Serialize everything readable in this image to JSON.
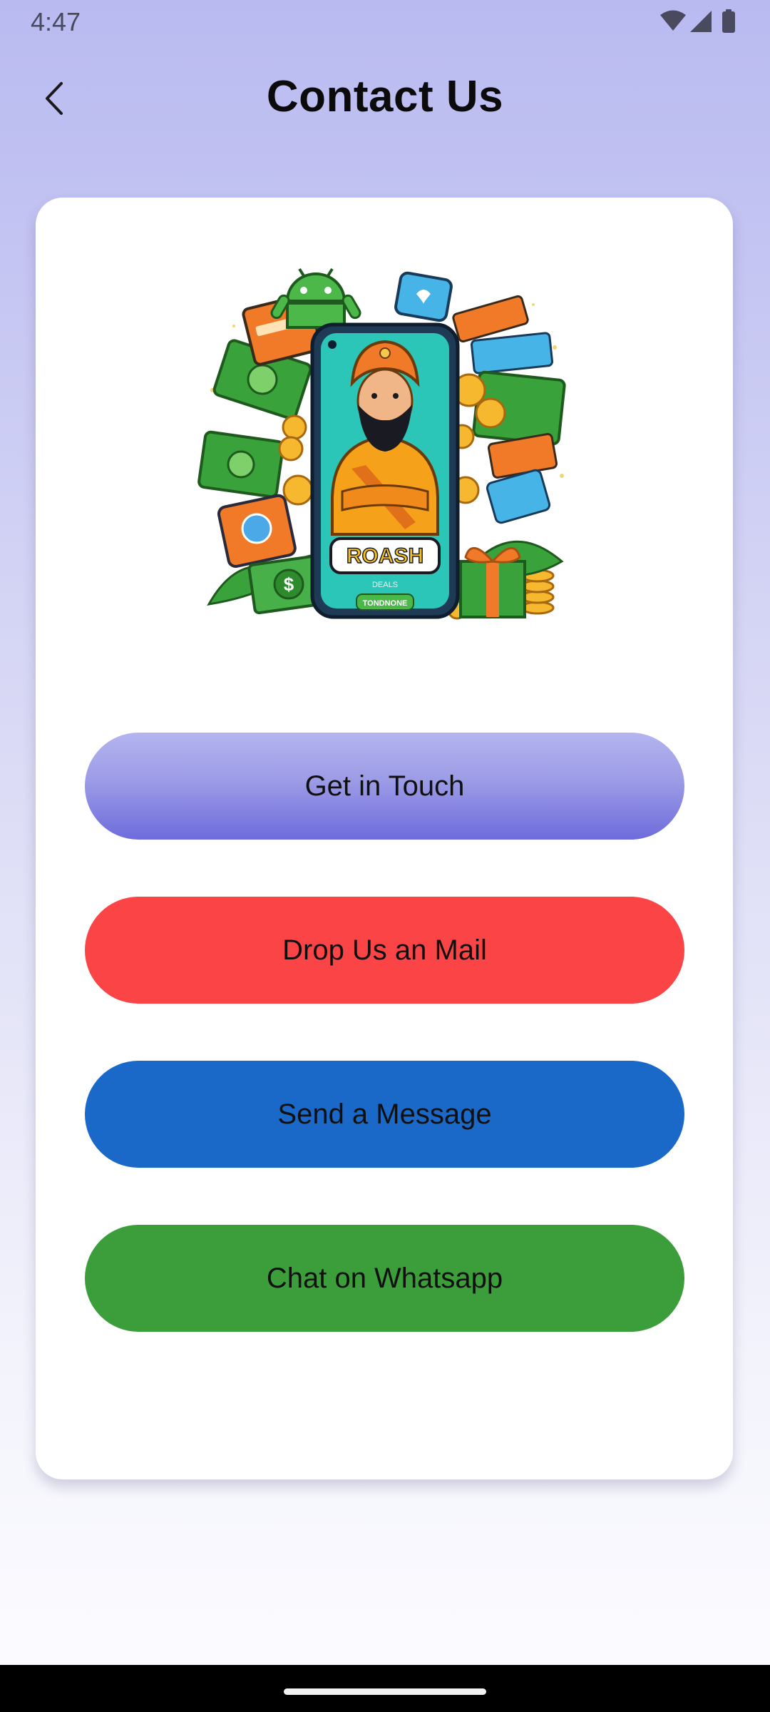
{
  "status_bar": {
    "time": "4:47",
    "icons": [
      "wifi-icon",
      "signal-icon",
      "battery-icon"
    ]
  },
  "header": {
    "title": "Contact Us",
    "back_icon": "chevron-left-icon"
  },
  "card": {
    "hero_image": {
      "brand_text": "ROASH",
      "sub_text": "DEALS",
      "button_text": "TONDNONE"
    },
    "buttons": [
      {
        "label": "Get in Touch",
        "color": "#8f8ee3"
      },
      {
        "label": "Drop Us an Mail",
        "color": "#fb4446"
      },
      {
        "label": "Send a Message",
        "color": "#1a68c8"
      },
      {
        "label": "Chat on Whatsapp",
        "color": "#3c9e3a"
      }
    ]
  },
  "colors": {
    "background_top": "#b9baf0",
    "background_bottom": "#fbfbff",
    "card": "#ffffff"
  }
}
